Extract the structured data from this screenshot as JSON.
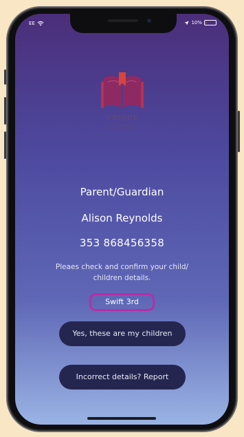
{
  "status": {
    "carrier": "EE",
    "battery": "10%",
    "battery_level": 0.1,
    "battery_color": "#e24a4a"
  },
  "logo": {
    "word1": "UNIQUE",
    "word2": "SCHOOL"
  },
  "guardian": {
    "role": "Parent/Guardian",
    "name": "Alison Reynolds",
    "phone": "353 868456358"
  },
  "message": {
    "line1": "Pleaes check and confirm your child/",
    "line2": "children details."
  },
  "children": [
    "Swift  3rd"
  ],
  "actions": {
    "confirm_label": "Yes, these are my children",
    "report_label": "Incorrect details? Report"
  },
  "colors": {
    "highlight": "#b42fa7",
    "button": "#252650",
    "gradient_top": "#4b2e7a",
    "gradient_bottom": "#9ab3e4",
    "page_bg": "#f9e6c4"
  }
}
